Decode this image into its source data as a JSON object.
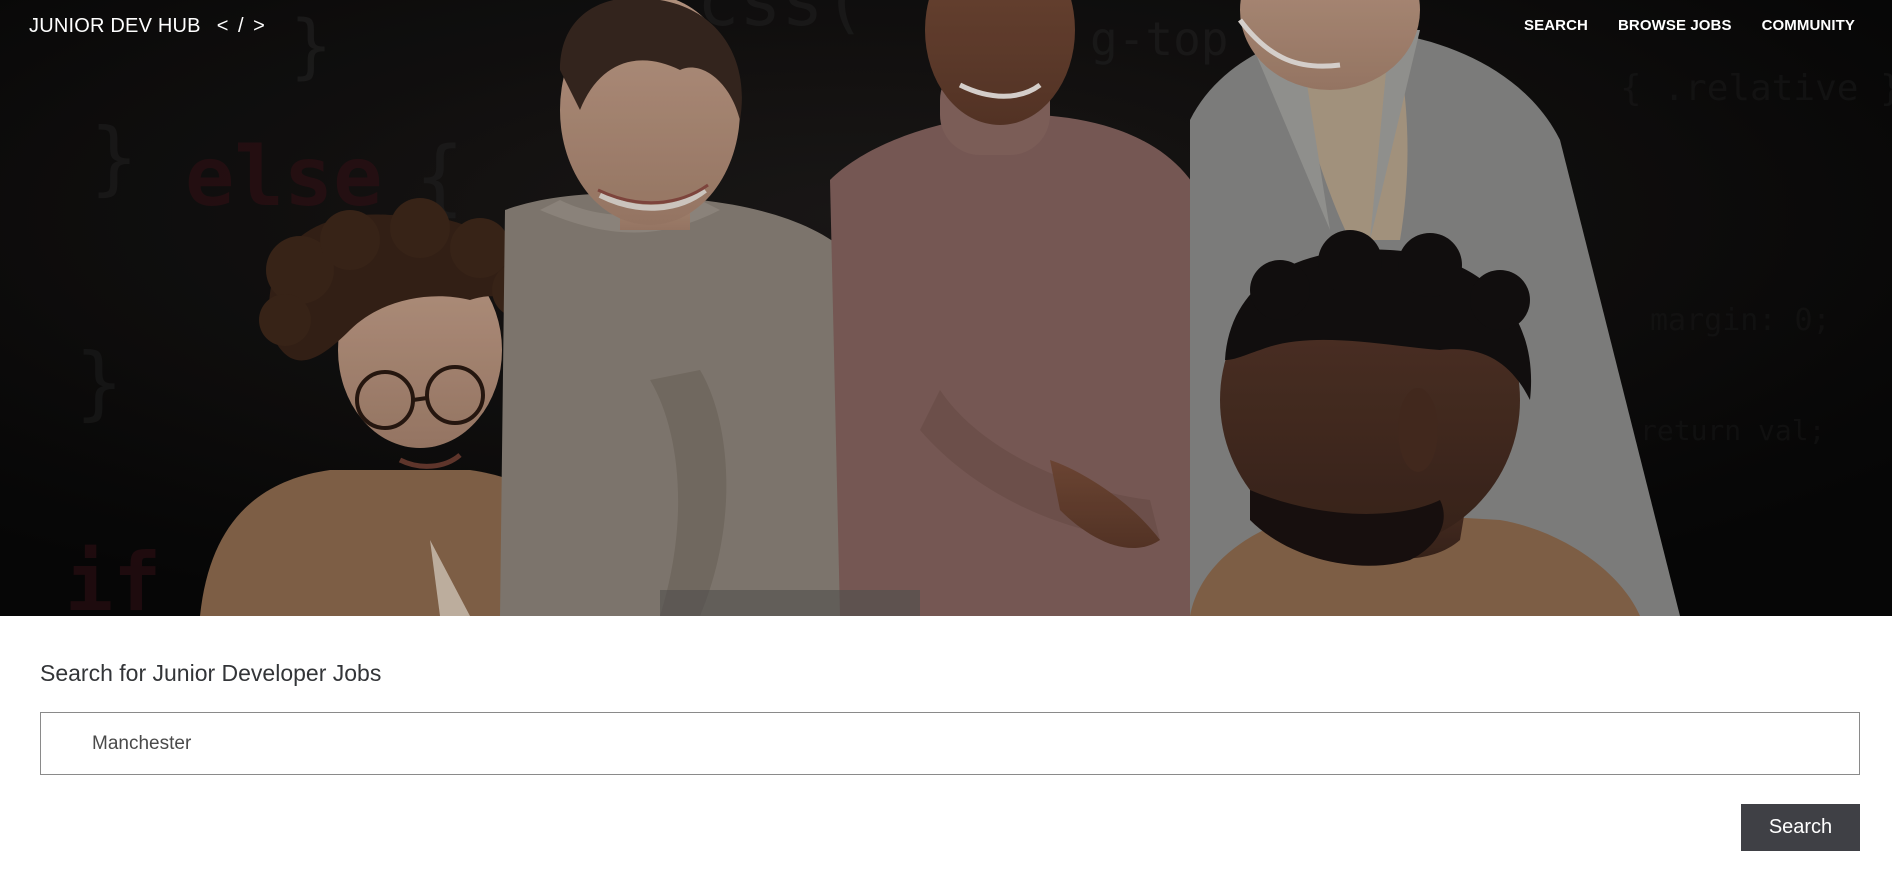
{
  "brand": {
    "name": "JUNIOR DEV HUB",
    "code_mark": "< / >"
  },
  "nav": {
    "items": [
      {
        "label": "SEARCH"
      },
      {
        "label": "BROWSE JOBS"
      },
      {
        "label": "COMMUNITY"
      }
    ]
  },
  "hero": {
    "background_code": [
      "}",
      "} else {",
      "}",
      "if",
      ".css(",
      "-top"
    ]
  },
  "search": {
    "heading": "Search for Junior Developer Jobs",
    "input_value": "Manchester",
    "button_label": "Search"
  },
  "colors": {
    "hero_bg": "#0c0b0b",
    "button_bg": "#3f4045",
    "heading_text": "#333538",
    "nav_text": "#ffffff"
  }
}
